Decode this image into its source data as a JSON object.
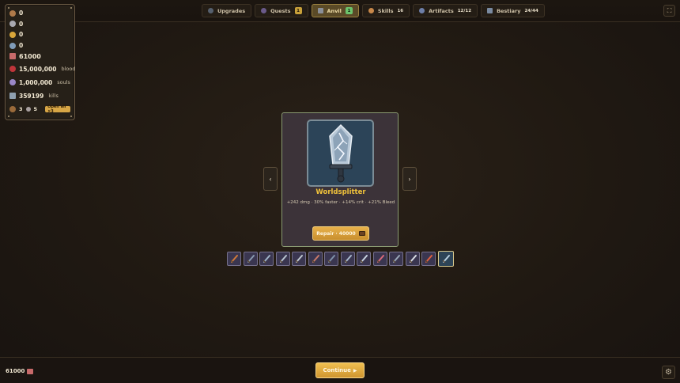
{
  "tabs": [
    {
      "label": "Upgrades",
      "badge": "",
      "count": ""
    },
    {
      "label": "Quests",
      "badge": "1",
      "count": ""
    },
    {
      "label": "Anvil",
      "badge": "1",
      "count": ""
    },
    {
      "label": "Skills",
      "badge": "",
      "count": "16"
    },
    {
      "label": "Artifacts",
      "badge": "",
      "count": "12/12"
    },
    {
      "label": "Bestiary",
      "badge": "",
      "count": "24/44"
    }
  ],
  "active_tab": "Anvil",
  "resources": {
    "items": [
      {
        "icon": "copper-coin-icon",
        "color": "#b07a4a",
        "value": "0",
        "unit": ""
      },
      {
        "icon": "silver-coin-icon",
        "color": "#a8a8b0",
        "value": "0",
        "unit": ""
      },
      {
        "icon": "gold-coin-icon",
        "color": "#d9a63a",
        "value": "0",
        "unit": ""
      },
      {
        "icon": "platinum-coin-icon",
        "color": "#7f9bb8",
        "value": "0",
        "unit": ""
      },
      {
        "icon": "crown-icon",
        "color": "#c86a6a",
        "value": "61000",
        "unit": ""
      },
      {
        "icon": "blood-drop-icon",
        "color": "#c0353a",
        "value": "15,000,000",
        "unit": "blood"
      },
      {
        "icon": "soul-icon",
        "color": "#9a88c8",
        "value": "1,000,000",
        "unit": "souls"
      },
      {
        "icon": "crossed-swords-icon",
        "color": "#8fa0b0",
        "value": "359199",
        "unit": "kills"
      }
    ],
    "chests": {
      "chest_count": "3",
      "key_count": "5",
      "open_all_label": "Open all ×3"
    }
  },
  "weapon": {
    "name": "Worldsplitter",
    "stats": "+242 dmg · 30% faster · +14% crit · +21% Bleed",
    "repair_label": "Repair · 40000"
  },
  "nav": {
    "prev": "‹",
    "next": "›"
  },
  "weapon_strip": [
    {
      "name": "weapon-slot-1",
      "color": "#d07a3a"
    },
    {
      "name": "weapon-slot-2",
      "color": "#8a9ab0"
    },
    {
      "name": "weapon-slot-3",
      "color": "#a0b4c8"
    },
    {
      "name": "weapon-slot-4",
      "color": "#b8c4d0"
    },
    {
      "name": "weapon-slot-5",
      "color": "#c0c8d0"
    },
    {
      "name": "weapon-slot-6",
      "color": "#c87a6a"
    },
    {
      "name": "weapon-slot-7",
      "color": "#7f90a8"
    },
    {
      "name": "weapon-slot-8",
      "color": "#a8b8cc"
    },
    {
      "name": "weapon-slot-9",
      "color": "#c8d4e0"
    },
    {
      "name": "weapon-slot-10",
      "color": "#d86a7a"
    },
    {
      "name": "weapon-slot-11",
      "color": "#9aa8b8"
    },
    {
      "name": "weapon-slot-12",
      "color": "#d8dce4"
    },
    {
      "name": "weapon-slot-13",
      "color": "#e06040"
    },
    {
      "name": "weapon-slot-14",
      "color": "#b8d0e0"
    }
  ],
  "active_weapon_index": 13,
  "bottom": {
    "gold_value": "61000",
    "continue_label": "Continue",
    "continue_glyph": "▶",
    "settings_glyph": "⚙",
    "fullscreen_glyph": "⛶"
  },
  "colors": {
    "accent_gold": "#f0c23a",
    "card_border": "#8a9a72",
    "weapon_bg": "#2c4458"
  }
}
